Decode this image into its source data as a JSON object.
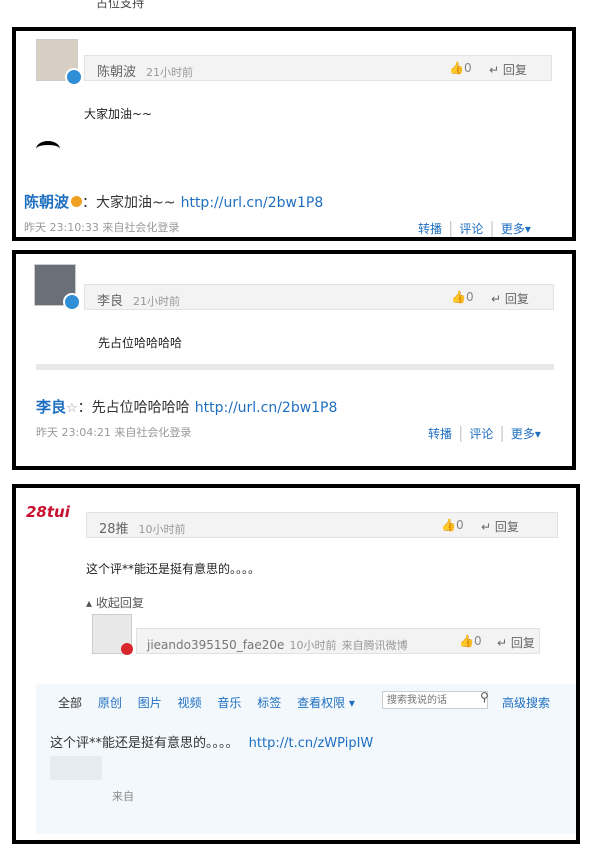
{
  "top_text": "占位支持",
  "card1": {
    "name": "陈朝波",
    "time": "21小时前",
    "like_count": "0",
    "reply_label": "回复",
    "content": "大家加油~~",
    "author": "陈朝波",
    "post_text": "：大家加油~~",
    "post_link": "http://url.cn/2bw1P8",
    "meta": "昨天 23:10:33  来自社会化登录",
    "action_forward": "转播",
    "action_comment": "评论",
    "action_more": "更多"
  },
  "card2": {
    "name": "李良",
    "time": "21小时前",
    "like_count": "0",
    "reply_label": "回复",
    "content": "先占位哈哈哈哈",
    "author": "李良",
    "post_text": "：先占位哈哈哈哈",
    "post_link": "http://url.cn/2bw1P8",
    "meta": "昨天 23:04:21  来自社会化登录",
    "action_forward": "转播",
    "action_comment": "评论",
    "action_more": "更多"
  },
  "card3": {
    "logo": "28tui",
    "name": "28推",
    "time": "10小时前",
    "like_count": "0",
    "reply_label": "回复",
    "content": "这个评**能还是挺有意思的。。。。",
    "collapse_label": "收起回复",
    "sub_name": "jieando395150_fae20e",
    "sub_time": "10小时前",
    "sub_source": "来自腾讯微博",
    "sub_like_count": "0",
    "sub_reply_label": "回复",
    "nav": [
      "全部",
      "原创",
      "图片",
      "视频",
      "音乐",
      "标签"
    ],
    "nav_dropdown": "查看权限",
    "search_placeholder": "搜索我说的话",
    "advanced_search": "高级搜索",
    "post_text": "这个评**能还是挺有意思的。。。。",
    "post_link": "http://t.cn/zWPipIW",
    "meta_from": "来自"
  }
}
